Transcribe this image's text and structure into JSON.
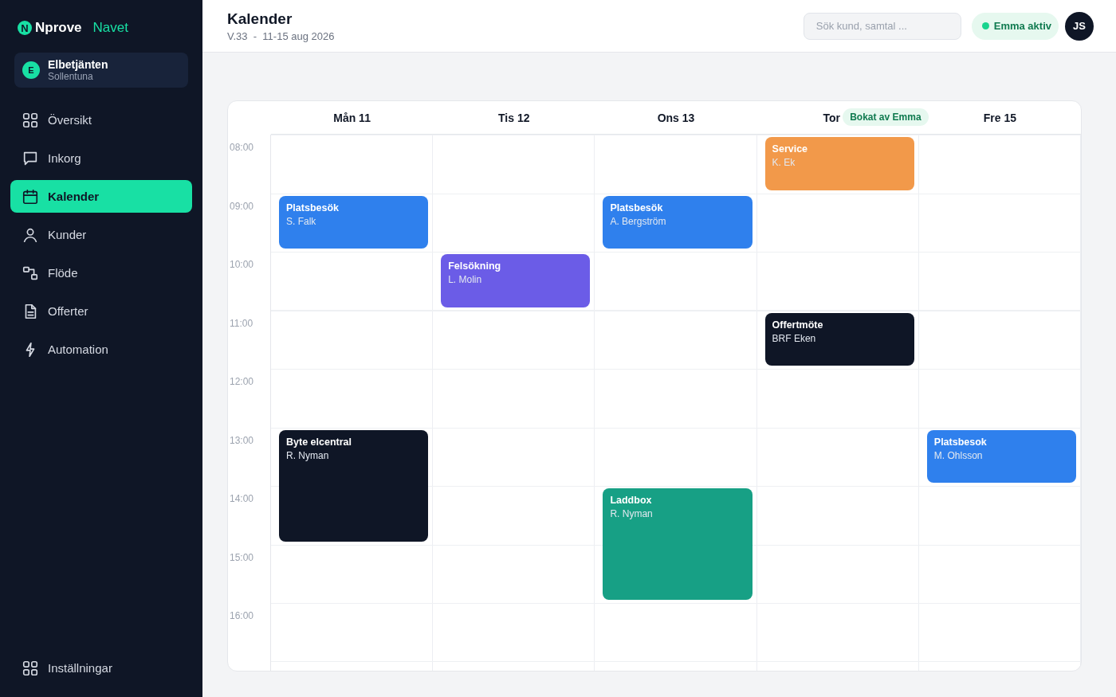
{
  "sidebar": {
    "logo": {
      "mark": "N",
      "name": "Nprove",
      "product": "Navet"
    },
    "org": {
      "initial": "E",
      "name": "Elbetjänten",
      "location": "Sollentuna"
    },
    "items": [
      {
        "label": "Översikt",
        "selected": false
      },
      {
        "label": "Inkorg",
        "selected": false
      },
      {
        "label": "Kalender",
        "selected": true
      },
      {
        "label": "Kunder",
        "selected": false
      },
      {
        "label": "Flöde",
        "selected": false
      },
      {
        "label": "Offerter",
        "selected": false
      },
      {
        "label": "Automation",
        "selected": false
      }
    ],
    "footer": {
      "label": "Inställningar"
    }
  },
  "header": {
    "title": "Kalender",
    "subtitle": "V.33  -  11-15 aug 2026",
    "search": {
      "placeholder": "Sök kund, samtal ..."
    },
    "status": {
      "label": "Emma aktiv"
    },
    "avatar": "JS"
  },
  "calendar": {
    "days": [
      {
        "label": "Mån 11"
      },
      {
        "label": "Tis 12"
      },
      {
        "label": "Ons 13"
      },
      {
        "label": "Tor",
        "badge": "Bokat av Emma"
      },
      {
        "label": "Fre 15"
      }
    ],
    "rows": [
      {
        "time": "08:00",
        "cells": [
          {},
          {},
          {},
          {
            "title": "Service",
            "who": "K. Ek",
            "color": "#f2994a",
            "kind": "short"
          },
          {}
        ]
      },
      {
        "time": "09:00",
        "cells": [
          {
            "title": "Platsbesök",
            "who": "S. Falk",
            "color": "#2f80ed",
            "kind": "short"
          },
          {},
          {
            "title": "Platsbesök",
            "who": "A. Bergström",
            "color": "#2f80ed",
            "kind": "short"
          },
          {},
          {}
        ]
      },
      {
        "time": "10:00",
        "cells": [
          {},
          {
            "title": "Felsökning",
            "who": "L. Molin",
            "color": "#6b5ce7",
            "kind": "short"
          },
          {},
          {},
          {}
        ]
      },
      {
        "time": "11:00",
        "cells": [
          {},
          {},
          {},
          {
            "title": "Offertmöte",
            "who": "BRF Eken",
            "color": "#0f1626",
            "kind": "short"
          },
          {}
        ]
      },
      {
        "time": "12:00",
        "cells": [
          {},
          {},
          {},
          {},
          {}
        ]
      },
      {
        "time": "13:00",
        "cells": [
          {
            "title": "Byte elcentral",
            "who": "R. Nyman",
            "color": "#0f1626",
            "kind": "long"
          },
          {},
          {},
          {},
          {
            "title": "Platsbesok",
            "who": "M. Ohlsson",
            "color": "#2f80ed",
            "kind": "short"
          }
        ]
      },
      {
        "time": "14:00",
        "cells": [
          {},
          {},
          {
            "title": "Laddbox",
            "who": "R. Nyman",
            "color": "#17a085",
            "kind": "long"
          },
          {},
          {}
        ]
      },
      {
        "time": "15:00",
        "cells": [
          {},
          {},
          {},
          {},
          {}
        ]
      },
      {
        "time": "16:00",
        "cells": [
          {},
          {},
          {},
          {},
          {}
        ]
      }
    ]
  }
}
